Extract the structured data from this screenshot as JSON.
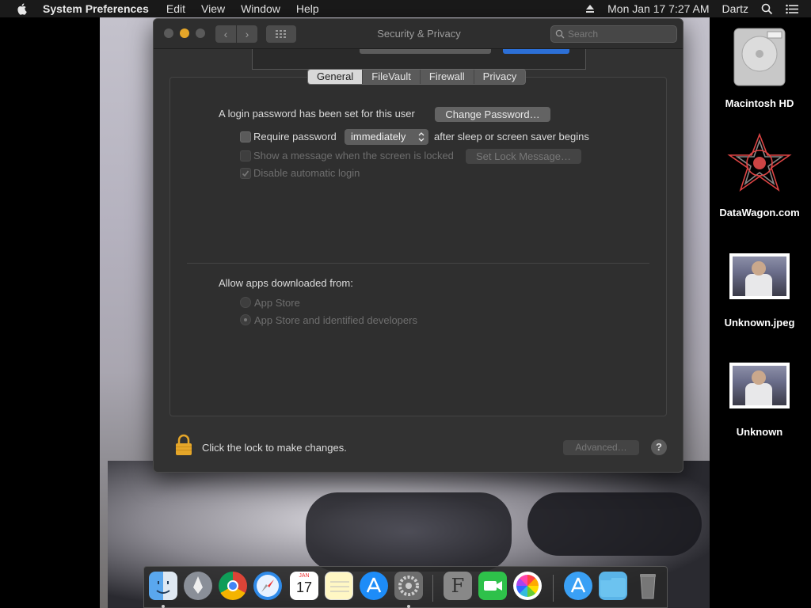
{
  "menubar": {
    "app_name": "System Preferences",
    "items": [
      "Edit",
      "View",
      "Window",
      "Help"
    ],
    "datetime": "Mon Jan 17  7:27 AM",
    "user": "Dartz"
  },
  "window": {
    "title": "Security & Privacy",
    "search_placeholder": "Search",
    "tabs": [
      "General",
      "FileVault",
      "Firewall",
      "Privacy"
    ],
    "active_tab": "General",
    "general": {
      "login_password_text": "A login password has been set for this user",
      "change_password_button": "Change Password…",
      "require_password_label": "Require password",
      "require_password_value": "immediately",
      "after_sleep_text": "after sleep or screen saver begins",
      "show_message_label": "Show a message when the screen is locked",
      "set_lock_message_button": "Set Lock Message…",
      "disable_auto_login_label": "Disable automatic login",
      "allow_apps_label": "Allow apps downloaded from:",
      "radio_app_store": "App Store",
      "radio_identified": "App Store and identified developers"
    },
    "footer": {
      "lock_text": "Click the lock to make changes.",
      "advanced_button": "Advanced…",
      "help_button": "?"
    }
  },
  "desktop_icons": [
    {
      "label": "Macintosh HD"
    },
    {
      "label": "DataWagon.com"
    },
    {
      "label": "Unknown.jpeg"
    },
    {
      "label": "Unknown"
    }
  ],
  "dock": {
    "calendar_month": "JAN",
    "calendar_day": "17",
    "font_app_letter": "F"
  },
  "colors": {
    "accent_yellow": "#e5a629",
    "sheet_button_blue": "#2c6fd6",
    "window_bg": "#323232"
  }
}
